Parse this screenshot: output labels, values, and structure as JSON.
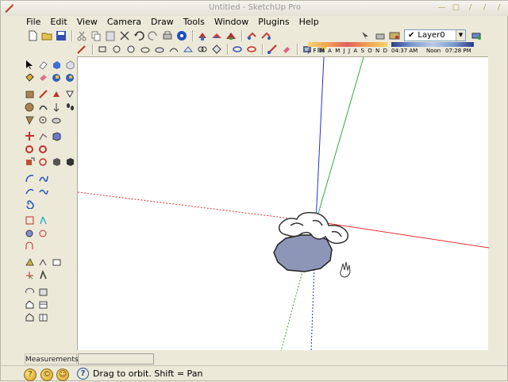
{
  "window": {
    "title": "Untitled - SketchUp Pro"
  },
  "menu": [
    "File",
    "Edit",
    "View",
    "Camera",
    "Draw",
    "Tools",
    "Window",
    "Plugins",
    "Help"
  ],
  "layers": {
    "current": "Layer0"
  },
  "shadows": {
    "months": [
      "J",
      "F",
      "M",
      "A",
      "M",
      "J",
      "J",
      "A",
      "S",
      "O",
      "N",
      "D"
    ],
    "time_start": "04:37 AM",
    "time_noon": "Noon",
    "time_end": "07:28 PM"
  },
  "measurements": {
    "label": "Measurements",
    "value": ""
  },
  "status": {
    "message": "Drag to orbit.  Shift = Pan"
  },
  "colors": {
    "red_axis": "#e03030",
    "green_axis": "#30b030",
    "blue_axis": "#2030d0",
    "face": "#8e96b8"
  }
}
